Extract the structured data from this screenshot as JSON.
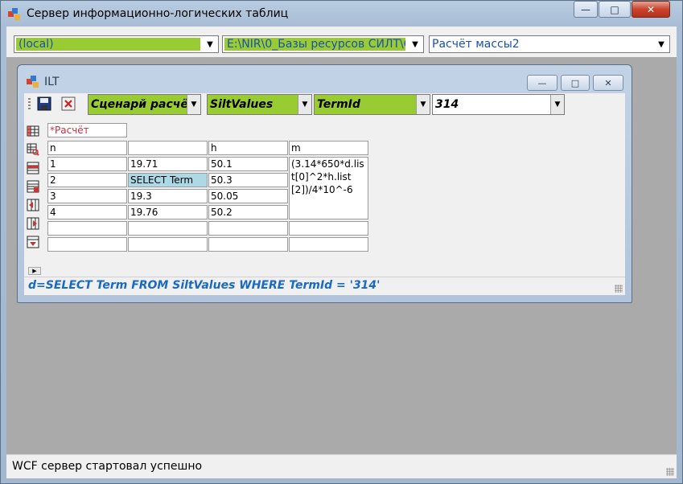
{
  "window": {
    "title": "Сервер информационно-логических таблиц",
    "min_icon": "minimize-icon",
    "max_icon": "maximize-icon",
    "close_icon": "close-icon"
  },
  "top_bar": {
    "server": "(local)",
    "path": "E:\\NIR\\0_Базы ресурсов СИЛТ\\С",
    "calculation": "Расчёт массы2"
  },
  "inner_window": {
    "title": "ILT"
  },
  "toolbar": {
    "scenario": "Сценарй расчё",
    "table": "SiltValues",
    "field": "TermId",
    "value": "314"
  },
  "grid": {
    "name": "*Расчёт",
    "headers": [
      "n",
      "",
      "h",
      "m"
    ],
    "rows": [
      [
        "1",
        "19.71",
        "50.1"
      ],
      [
        "2",
        "SELECT Term",
        "50.3"
      ],
      [
        "3",
        "19.3",
        "50.05"
      ],
      [
        "4",
        "19.76",
        "50.2"
      ],
      [
        "",
        "",
        "",
        ""
      ],
      [
        "",
        "",
        "",
        ""
      ]
    ],
    "m_formula": "(3.14*650*d.list[0]^2*h.list[2])/4*10^-6"
  },
  "formula_bar": "d=SELECT Term FROM SiltValues WHERE TermId = '314'",
  "status": "WCF сервер стартовал успешно",
  "colors": {
    "combo_fill": "#99cc33",
    "link_blue": "#1a4fb4",
    "formula_blue": "#1a6ac2",
    "name_red": "#c03040",
    "selected_cell": "#add8e6"
  }
}
